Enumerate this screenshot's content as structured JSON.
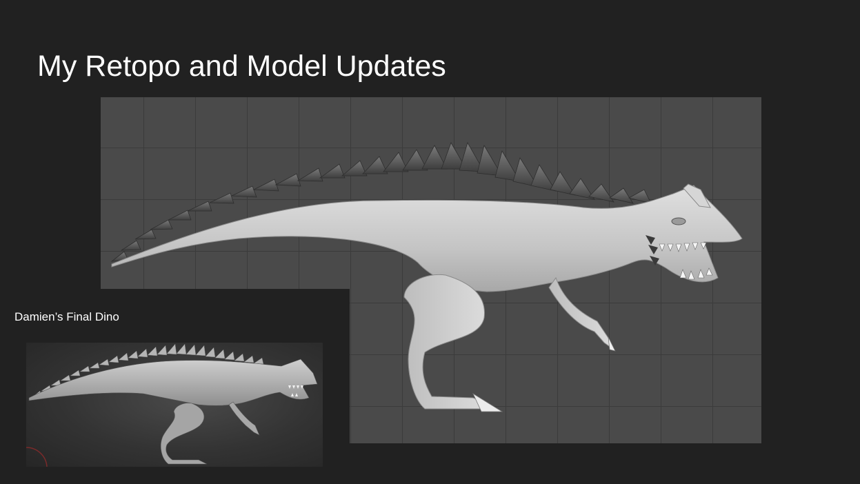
{
  "slide": {
    "title": "My Retopo and Model Updates",
    "caption": "Damien’s Final Dino"
  },
  "colors": {
    "background": "#212121",
    "viewport_grid_fill": "#4a4a4a",
    "grid_line": "#3b3b3b",
    "model_light": "#cfcfcf",
    "spikes_dark": "#5a5a5a",
    "text": "#ffffff"
  },
  "images": {
    "main_model": "dinosaur-retopo-render",
    "reference": "damien-final-dino-render"
  }
}
